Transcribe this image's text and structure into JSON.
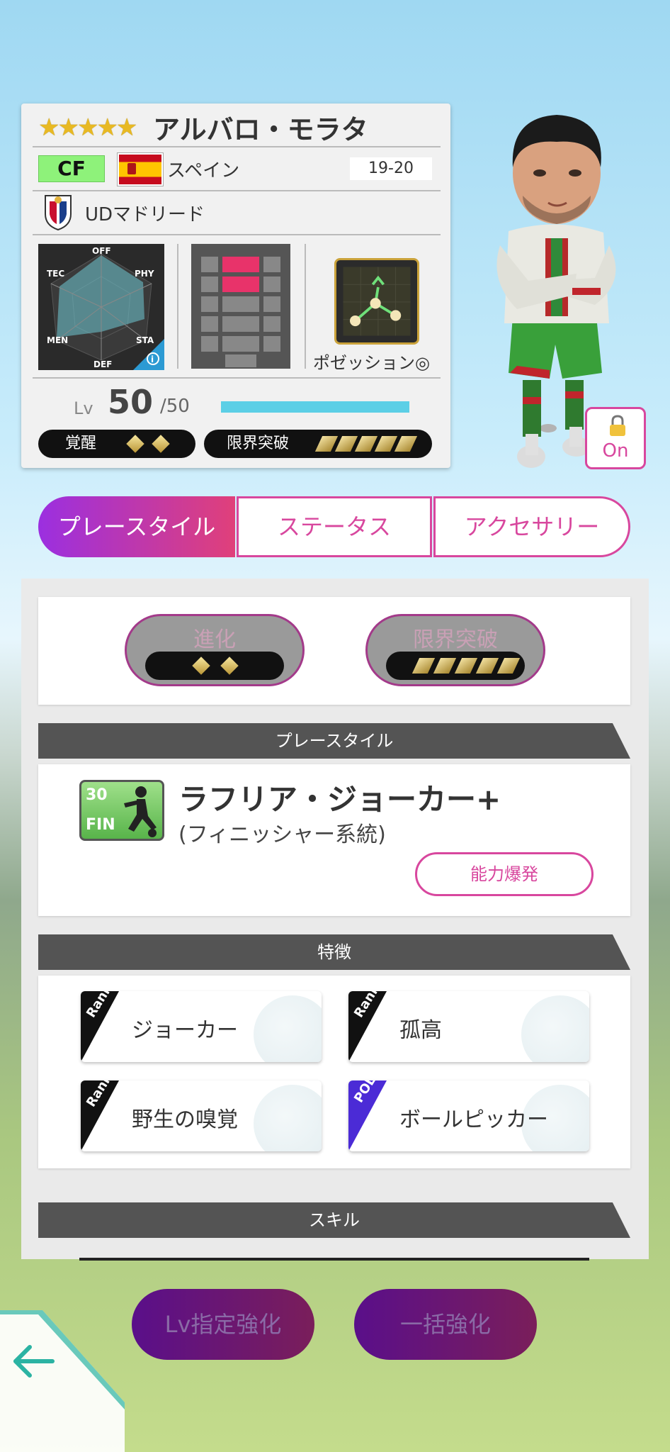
{
  "player": {
    "stars": "★★★★★",
    "name": "アルバロ・モラタ",
    "position": "CF",
    "country": "スペイン",
    "season": "19-20",
    "team": "UDマドリード",
    "radar_labels": [
      "OFF",
      "PHY",
      "STA",
      "DEF",
      "MEN",
      "TEC"
    ],
    "play_style_short": "ポゼッション◎",
    "lv_label": "Lv",
    "level": "50",
    "level_max": "/50",
    "level_progress": 1.0,
    "awaken_label": "覚醒",
    "awaken_count": 2,
    "limit_label": "限界突破",
    "limit_count": 5
  },
  "lock": {
    "label": "On",
    "icon": "lock-icon"
  },
  "tabs": [
    {
      "label": "プレースタイル",
      "active": true
    },
    {
      "label": "ステータス",
      "active": false
    },
    {
      "label": "アクセサリー",
      "active": false
    }
  ],
  "evolve": {
    "label": "進化",
    "count": 2
  },
  "limit_break": {
    "label": "限界突破",
    "count": 5
  },
  "sections": {
    "playstyle_title": "プレースタイル",
    "traits_title": "特徴",
    "skills_title": "スキル"
  },
  "playstyle": {
    "icon_number": "30",
    "icon_code": "FIN",
    "name": "ラフリア・ジョーカー+",
    "sub": "(フィニッシャー系統)",
    "burst_button": "能力爆発"
  },
  "traits": [
    {
      "rank": "Rank S",
      "name": "ジョーカー",
      "badge": "rank"
    },
    {
      "rank": "Rank S",
      "name": "孤高",
      "badge": "rank"
    },
    {
      "rank": "Rank S",
      "name": "野生の嗅覚",
      "badge": "rank"
    },
    {
      "rank": "POL",
      "name": "ボールピッカー",
      "badge": "pol"
    }
  ],
  "bottom": {
    "lv_button": "Lv指定強化",
    "bulk_button": "一括強化",
    "back_icon": "back-arrow-icon"
  },
  "colors": {
    "accent": "#d8479e",
    "tab_gradient_start": "#9b2fe0",
    "tab_gradient_end": "#e0407a",
    "level_bar": "#5ccfe6"
  }
}
